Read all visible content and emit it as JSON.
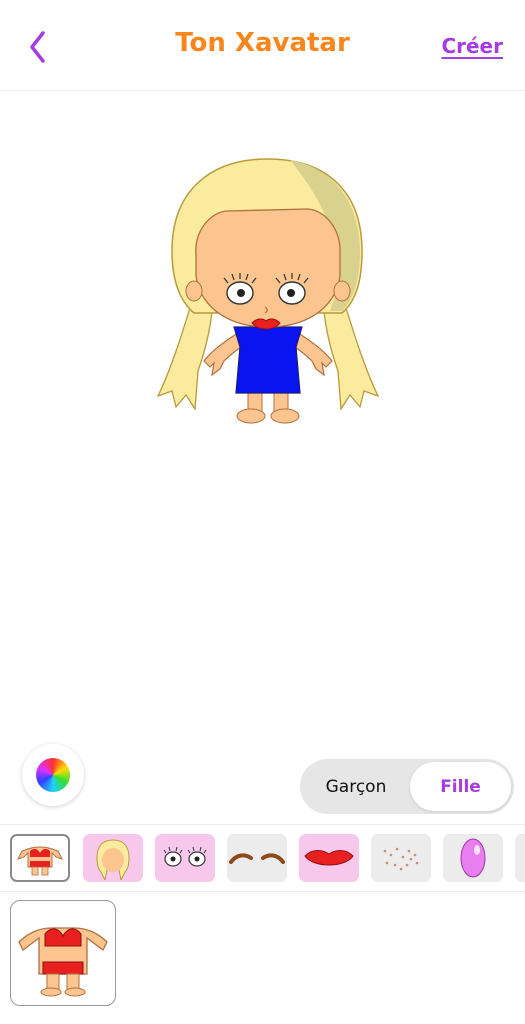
{
  "header": {
    "title": "Ton Xavatar",
    "create_label": "Créer"
  },
  "gender_toggle": {
    "options": [
      "Garçon",
      "Fille"
    ],
    "selected": "Fille"
  },
  "categories": [
    {
      "icon": "body-icon",
      "selected": true
    },
    {
      "icon": "hair-icon",
      "selected": false
    },
    {
      "icon": "eyes-icon",
      "selected": false
    },
    {
      "icon": "eyebrows-icon",
      "selected": false
    },
    {
      "icon": "lips-icon",
      "selected": false
    },
    {
      "icon": "freckles-icon",
      "selected": false
    },
    {
      "icon": "makeup-icon",
      "selected": false
    },
    {
      "icon": "glasses-icon",
      "selected": false
    }
  ],
  "colors": {
    "accent": "#a63ce3",
    "title": "#f7861d",
    "skin": "#fcc48e",
    "hair": "#fbeb9e",
    "dress": "#0a14f0"
  }
}
